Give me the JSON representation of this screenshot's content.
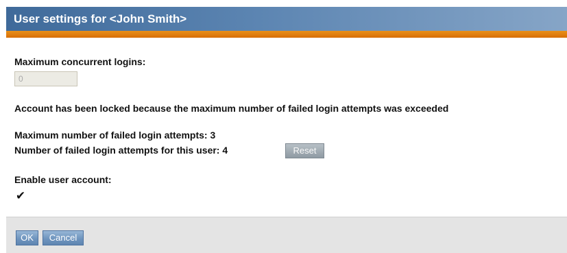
{
  "dialog": {
    "title": "User settings for <John Smith>"
  },
  "settings": {
    "max_concurrent_logins_label": "Maximum concurrent logins:",
    "max_concurrent_logins_value": "0",
    "lock_message": "Account has been locked because the maximum number of failed login attempts was exceeded",
    "max_failed_attempts_label": "Maximum number of failed login attempts: 3",
    "failed_attempts_label": "Number of failed login attempts for this user: 4",
    "reset_label": "Reset",
    "enable_account_label": "Enable user account:",
    "enable_account_checked": true,
    "checkmark_glyph": "✔"
  },
  "footer": {
    "ok_label": "OK",
    "cancel_label": "Cancel"
  },
  "colors": {
    "title_bar": "#4f7aa8",
    "accent": "#e07b0c",
    "button": "#6f95bf",
    "footer_bg": "#e4e4e4"
  }
}
